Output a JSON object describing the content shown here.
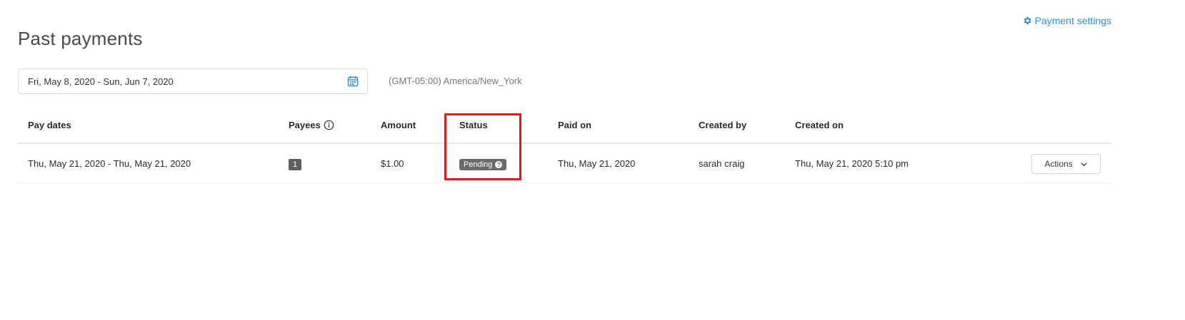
{
  "page": {
    "title": "Past payments"
  },
  "header": {
    "settings_label": "Payment settings"
  },
  "filters": {
    "date_range": "Fri, May 8, 2020 - Sun, Jun 7, 2020",
    "timezone": "(GMT-05:00) America/New_York"
  },
  "table": {
    "columns": {
      "pay_dates": "Pay dates",
      "payees": "Payees",
      "amount": "Amount",
      "status": "Status",
      "paid_on": "Paid on",
      "created_by": "Created by",
      "created_on": "Created on"
    },
    "rows": [
      {
        "pay_dates": "Thu, May 21, 2020 - Thu, May 21, 2020",
        "payees": "1",
        "amount": "$1.00",
        "status": "Pending",
        "paid_on": "Thu, May 21, 2020",
        "created_by": "sarah craig",
        "created_on": "Thu, May 21, 2020 5:10 pm",
        "actions_label": "Actions"
      }
    ]
  },
  "colors": {
    "link": "#2b8fd6",
    "status_badge": "#6b6b6b",
    "highlight": "#e01a1a"
  }
}
